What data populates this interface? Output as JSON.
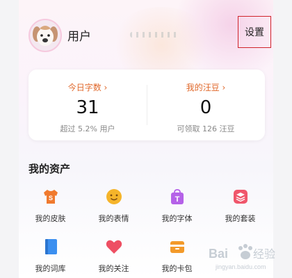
{
  "profile": {
    "username": "用户",
    "settings_label": "设置"
  },
  "stats": {
    "left": {
      "label": "今日字数 ›",
      "value": "31",
      "sub": "超过 5.2% 用户"
    },
    "right": {
      "label": "我的汪豆 ›",
      "value": "0",
      "sub": "可领取 126 汪豆"
    }
  },
  "assets": {
    "title": "我的资产",
    "items": [
      {
        "label": "我的皮肤",
        "icon": "shirt-icon",
        "color": "#f07a2e"
      },
      {
        "label": "我的表情",
        "icon": "emoji-icon",
        "color": "#f5b42a"
      },
      {
        "label": "我的字体",
        "icon": "font-bag-icon",
        "color": "#b561e8"
      },
      {
        "label": "我的套装",
        "icon": "layers-icon",
        "color": "#f0566b"
      },
      {
        "label": "我的词库",
        "icon": "book-icon",
        "color": "#3b8ff0"
      },
      {
        "label": "我的关注",
        "icon": "heart-icon",
        "color": "#ee4f63"
      },
      {
        "label": "我的卡包",
        "icon": "card-icon",
        "color": "#f39a2a"
      }
    ]
  },
  "watermark": {
    "brand": "Bai",
    "sub": "jingyan.baidu.com"
  }
}
